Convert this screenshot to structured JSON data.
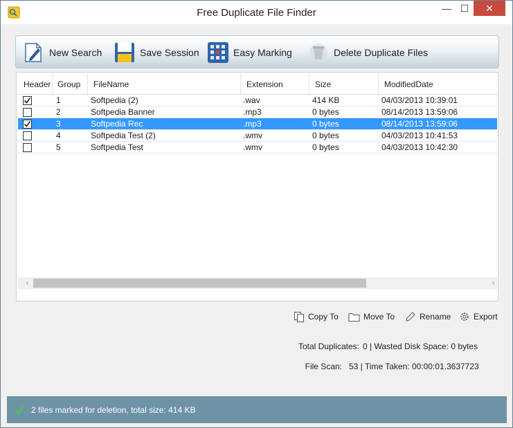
{
  "window": {
    "title": "Free Duplicate File Finder",
    "minimize": "—",
    "maximize": "☐",
    "close": "✕"
  },
  "toolbar": {
    "new_search": "New Search",
    "save_session": "Save Session",
    "easy_marking": "Easy Marking",
    "delete_duplicates": "Delete Duplicate Files"
  },
  "grid": {
    "columns": [
      "Header",
      "Group",
      "FileName",
      "Extension",
      "Size",
      "ModifiedDate"
    ],
    "rows": [
      {
        "checked": true,
        "selected": false,
        "group": "1",
        "filename": "Softpedia (2)",
        "extension": ".wav",
        "size": "414 KB",
        "modified": "04/03/2013 10:39:01"
      },
      {
        "checked": false,
        "selected": false,
        "group": "2",
        "filename": "Softpedia Banner",
        "extension": ".mp3",
        "size": "0 bytes",
        "modified": "08/14/2013 13:59:06"
      },
      {
        "checked": true,
        "selected": true,
        "group": "3",
        "filename": "Softpedia Rec",
        "extension": ".mp3",
        "size": "0 bytes",
        "modified": "08/14/2013 13:59:06"
      },
      {
        "checked": false,
        "selected": false,
        "group": "4",
        "filename": "Softpedia Test (2)",
        "extension": ".wmv",
        "size": "0 bytes",
        "modified": "04/03/2013 10:41:53"
      },
      {
        "checked": false,
        "selected": false,
        "group": "5",
        "filename": "Softpedia Test",
        "extension": ".wmv",
        "size": "0 bytes",
        "modified": "04/03/2013 10:42:30"
      }
    ],
    "scroll_left": "‹",
    "scroll_right": "›"
  },
  "actions": {
    "copy_to": "Copy To",
    "move_to": "Move To",
    "rename": "Rename",
    "export": "Export"
  },
  "stats": {
    "total_duplicates_label": "Total Duplicates:",
    "total_duplicates_value": "0 | Wasted Disk Space: 0 bytes",
    "file_scan_label": "File Scan:",
    "file_scan_value": "53 | Time Taken: 00:00:01.3637723"
  },
  "status": {
    "text": "2 files marked for deletion, total size: 414 KB"
  },
  "colors": {
    "selection": "#3399ff",
    "status_bar": "#6f93a6",
    "close_button": "#c74a40"
  }
}
